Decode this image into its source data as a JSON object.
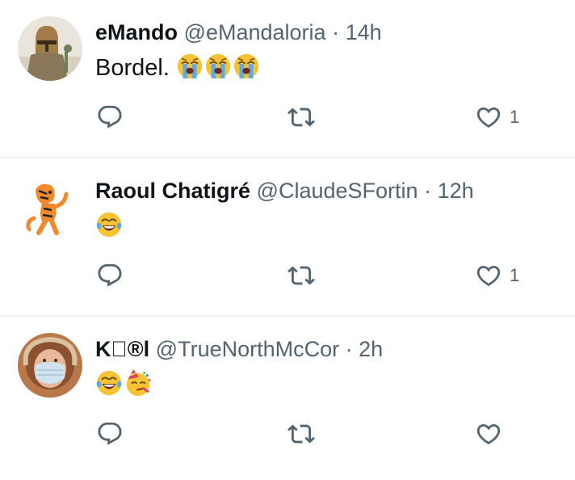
{
  "tweets": [
    {
      "name": "eMando",
      "handle": "@eMandaloria",
      "separator": "·",
      "time": "14h",
      "text": "Bordel.",
      "emojis": [
        "loudly-crying-face",
        "loudly-crying-face",
        "loudly-crying-face"
      ],
      "like_count": "1"
    },
    {
      "name": "Raoul Chatigré",
      "handle": "@ClaudeSFortin",
      "separator": "·",
      "time": "12h",
      "text": "",
      "emojis": [
        "face-with-tears-of-joy"
      ],
      "like_count": "1"
    },
    {
      "name": "K®l",
      "name_parts": [
        "K",
        "apple-logo",
        "circled-R",
        "l"
      ],
      "handle": "@TrueNorthMcCor",
      "separator": "·",
      "time": "2h",
      "text": "",
      "emojis": [
        "face-with-tears-of-joy",
        "partying-face"
      ],
      "like_count": ""
    }
  ],
  "colors": {
    "text": "#0f1419",
    "secondary": "#536471",
    "divider": "#eff3f4",
    "emoji_yellow": "#f7c233",
    "tears_blue": "#5fa9e6"
  }
}
